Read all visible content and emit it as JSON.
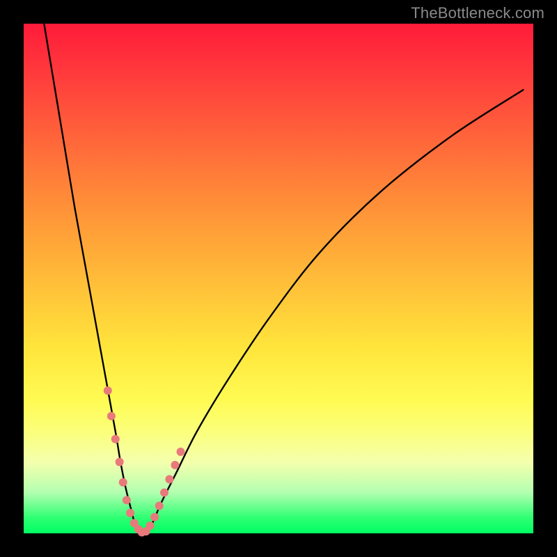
{
  "watermark": "TheBottleneck.com",
  "colors": {
    "frame": "#000000",
    "curve": "#000000",
    "dot": "#e87a7b",
    "gradient_top": "#ff1b3a",
    "gradient_bottom": "#00ff63"
  },
  "chart_data": {
    "type": "line",
    "title": "",
    "xlabel": "",
    "ylabel": "",
    "xlim": [
      0,
      100
    ],
    "ylim": [
      0,
      100
    ],
    "series": [
      {
        "name": "bottleneck-curve",
        "x": [
          4,
          6,
          8,
          10,
          12,
          14,
          16,
          18,
          19,
          20,
          21,
          22,
          23.5,
          25,
          27,
          30,
          34,
          40,
          48,
          58,
          70,
          84,
          98
        ],
        "y": [
          100,
          88,
          76,
          64,
          53,
          42,
          31,
          20,
          14,
          9,
          5,
          1.5,
          0,
          1.5,
          6,
          12,
          20,
          30,
          42,
          55,
          67,
          78,
          87
        ]
      }
    ],
    "dots": {
      "name": "highlight-dots",
      "x": [
        16.5,
        17.2,
        18.0,
        18.8,
        19.5,
        20.2,
        20.9,
        21.7,
        22.5,
        23.2,
        24.0,
        24.8,
        25.7,
        26.6,
        27.6,
        28.6,
        29.7,
        30.8
      ],
      "y": [
        28.0,
        23.0,
        18.5,
        14.0,
        10.0,
        6.5,
        4.0,
        2.0,
        0.8,
        0.2,
        0.4,
        1.5,
        3.2,
        5.4,
        8.0,
        10.6,
        13.4,
        16.0
      ],
      "radius": 6
    }
  }
}
